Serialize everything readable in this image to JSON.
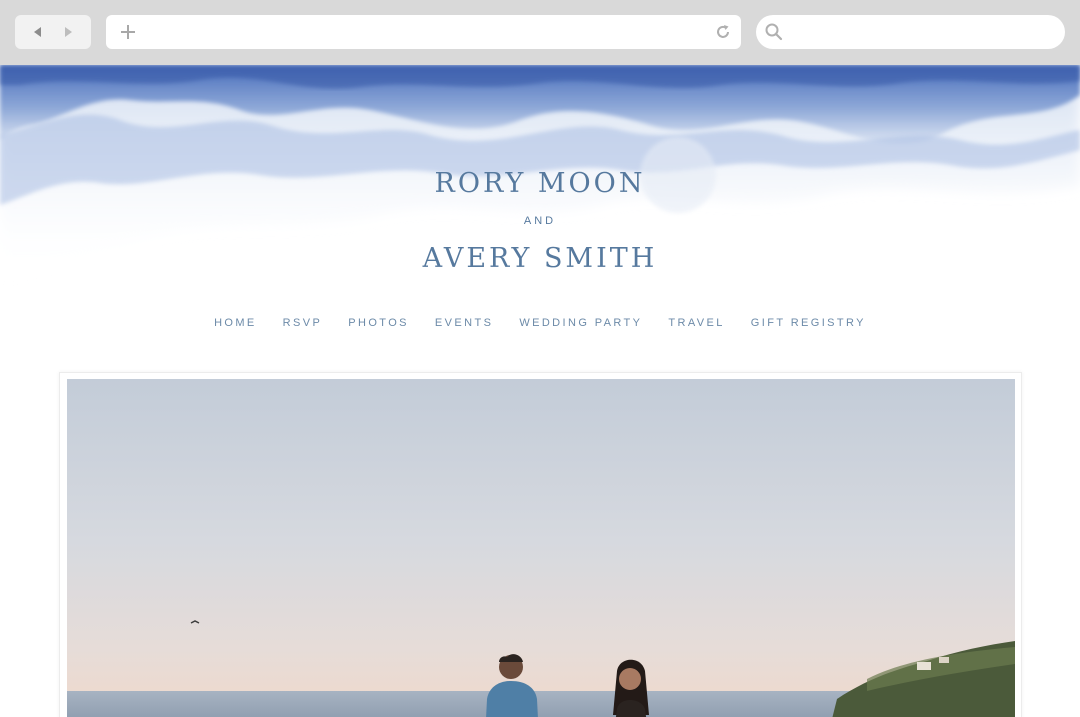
{
  "browser": {
    "back_icon": "back-arrow-icon",
    "forward_icon": "forward-arrow-icon",
    "new_tab_icon": "plus-icon",
    "reload_icon": "reload-icon",
    "search_icon": "search-icon",
    "search_value": ""
  },
  "header": {
    "partner_one": "RORY MOON",
    "conjunction": "AND",
    "partner_two": "AVERY SMITH"
  },
  "nav": {
    "items": [
      {
        "label": "HOME"
      },
      {
        "label": "RSVP"
      },
      {
        "label": "PHOTOS"
      },
      {
        "label": "EVENTS"
      },
      {
        "label": "WEDDING PARTY"
      },
      {
        "label": "TRAVEL"
      },
      {
        "label": "GIFT REGISTRY"
      }
    ]
  },
  "colors": {
    "accent": "#56799e",
    "nav_text": "#6c8aa8",
    "watercolor": "#3f64b3",
    "chrome": "#d9d9d9"
  }
}
